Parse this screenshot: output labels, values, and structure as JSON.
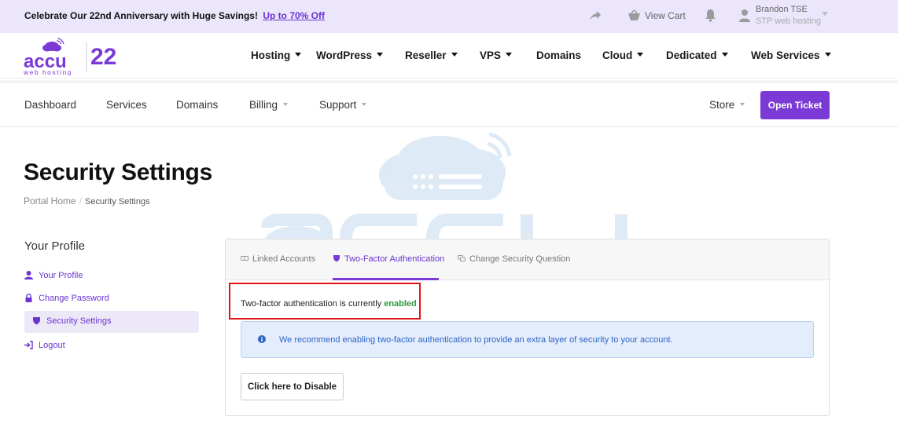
{
  "promo": {
    "text": "Celebrate Our 22nd Anniversary with Huge Savings!",
    "link": "Up to 70% Off"
  },
  "topbar": {
    "view_cart": "View Cart",
    "user_name": "Brandon TSE",
    "user_company": "STP web hosting"
  },
  "logo": {
    "brand": "accu",
    "tagline": "web hosting",
    "anniversary": "22"
  },
  "main_nav": [
    {
      "label": "Hosting"
    },
    {
      "label": "WordPress"
    },
    {
      "label": "Reseller"
    },
    {
      "label": "VPS"
    },
    {
      "label": "Domains"
    },
    {
      "label": "Cloud"
    },
    {
      "label": "Dedicated"
    },
    {
      "label": "Web Services"
    }
  ],
  "sub_nav": {
    "dashboard": "Dashboard",
    "services": "Services",
    "domains": "Domains",
    "billing": "Billing",
    "support": "Support",
    "store": "Store",
    "open_ticket": "Open Ticket"
  },
  "page": {
    "title": "Security Settings",
    "breadcrumb_home": "Portal Home",
    "breadcrumb_sep": "/",
    "breadcrumb_current": "Security Settings"
  },
  "sidebar": {
    "title": "Your Profile",
    "items": [
      {
        "label": "Your Profile",
        "icon": "user-icon"
      },
      {
        "label": "Change Password",
        "icon": "lock-icon"
      },
      {
        "label": "Security Settings",
        "icon": "shield-icon",
        "active": true
      },
      {
        "label": "Logout",
        "icon": "sign-out-icon"
      }
    ]
  },
  "tabs": [
    {
      "label": "Linked Accounts",
      "icon": "link-icon"
    },
    {
      "label": "Two-Factor Authentication",
      "icon": "shield-icon",
      "active": true
    },
    {
      "label": "Change Security Question",
      "icon": "comments-icon"
    }
  ],
  "two_factor": {
    "status_prefix": "Two-factor authentication is currently",
    "status_value": "enabled",
    "info": "We recommend enabling two-factor authentication to provide an extra layer of security to your account.",
    "disable_button": "Click here to Disable"
  },
  "colors": {
    "accent": "#7b3ad6",
    "promo_bg": "#ebe6fb",
    "enabled": "#2e9a3a",
    "info_text": "#2f65c6",
    "highlight": "#e01515"
  }
}
